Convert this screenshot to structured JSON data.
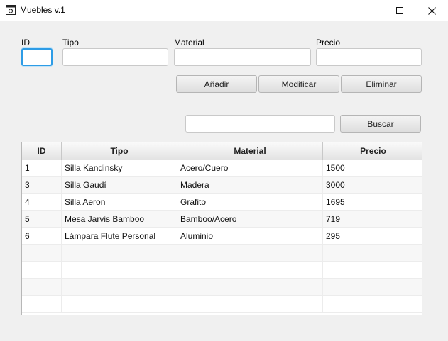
{
  "window": {
    "title": "Muebles v.1",
    "icon": "app-window-icon"
  },
  "form": {
    "id_label": "ID",
    "tipo_label": "Tipo",
    "material_label": "Material",
    "precio_label": "Precio",
    "id_value": "",
    "tipo_value": "",
    "material_value": "",
    "precio_value": ""
  },
  "actions": {
    "add": "Añadir",
    "modify": "Modificar",
    "delete": "Eliminar"
  },
  "search": {
    "value": "",
    "button": "Buscar"
  },
  "table": {
    "columns": [
      "ID",
      "Tipo",
      "Material",
      "Precio"
    ],
    "rows": [
      [
        "1",
        "Silla Kandinsky",
        "Acero/Cuero",
        "1500"
      ],
      [
        "3",
        "Silla Gaudí",
        "Madera",
        "3000"
      ],
      [
        "4",
        "Silla Aeron",
        "Grafito",
        "1695"
      ],
      [
        "5",
        "Mesa Jarvis Bamboo",
        "Bamboo/Acero",
        "719"
      ],
      [
        "6",
        "Lámpara Flute Personal",
        "Aluminio",
        "295"
      ]
    ],
    "empty_rows": 4
  },
  "colors": {
    "focus": "#2d9ce6",
    "background": "#f0f0f0"
  }
}
